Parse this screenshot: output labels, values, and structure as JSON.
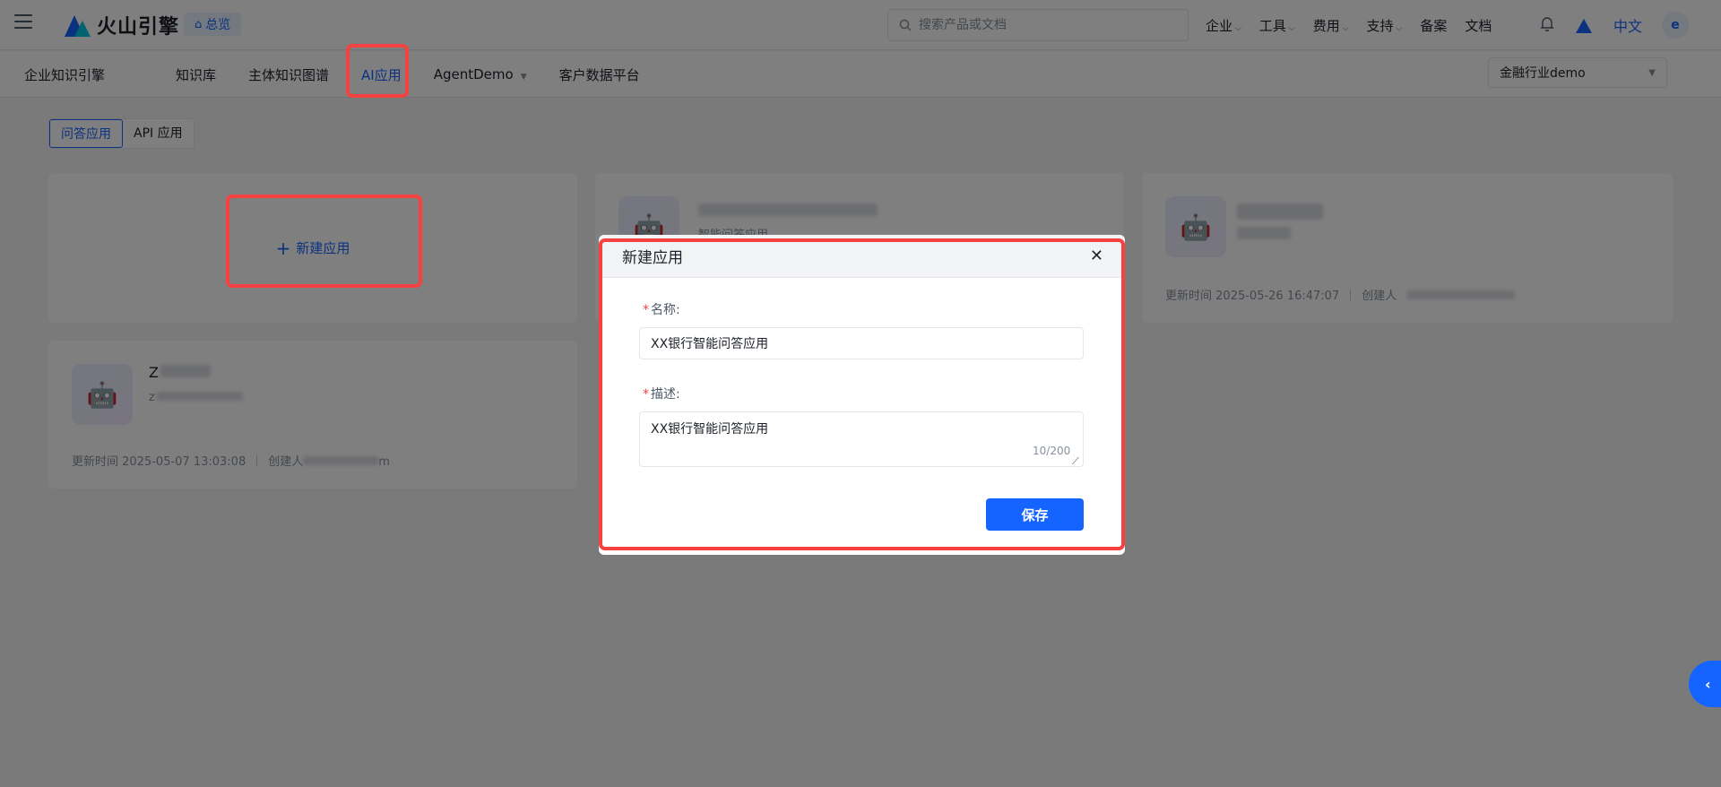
{
  "topbar": {
    "logo_text": "火山引擎",
    "home_label": "总览",
    "search_placeholder": "搜索产品或文档",
    "nav": [
      {
        "label": "企业",
        "has_caret": true
      },
      {
        "label": "工具",
        "has_caret": true
      },
      {
        "label": "费用",
        "has_caret": true
      },
      {
        "label": "支持",
        "has_caret": true
      },
      {
        "label": "备案",
        "has_caret": false
      },
      {
        "label": "文档",
        "has_caret": false
      }
    ],
    "language": "中文",
    "avatar_letter": "e"
  },
  "subnav": {
    "brand": "企业知识引擎",
    "tabs": [
      {
        "label": "知识库"
      },
      {
        "label": "主体知识图谱"
      },
      {
        "label": "AI应用",
        "active": true
      },
      {
        "label": "AgentDemo"
      },
      {
        "label": "客户数据平台"
      }
    ],
    "workspace_select": "金融行业demo"
  },
  "segment": {
    "items": [
      "问答应用",
      "API 应用"
    ],
    "active_index": 0
  },
  "new_app_card": {
    "label": "新建应用"
  },
  "app_cards": [
    {
      "title": "Z",
      "sub": "z",
      "updated_label": "更新时间",
      "updated_at": "2025-05-07 13:03:08",
      "creator_label": "创建人",
      "creator_suffix": "m"
    },
    {
      "sub": "智能问答应用"
    },
    {
      "updated_label": "更新时间",
      "updated_at": "2025-05-26 16:47:07",
      "creator_label": "创建人"
    }
  ],
  "modal": {
    "title": "新建应用",
    "name_label": "名称:",
    "name_value": "XX银行智能问答应用",
    "desc_label": "描述:",
    "desc_value": "XX银行智能问答应用",
    "desc_counter": "10/200",
    "save_label": "保存",
    "required_mark": "*"
  },
  "colors": {
    "accent": "#1664ff",
    "highlight": "#f5413f",
    "required": "#f53f3f"
  },
  "icons": {
    "menu": "hamburger-icon",
    "home": "home-icon",
    "search": "search-icon",
    "bell": "bell-icon",
    "close": "close-icon",
    "robot": "robot-icon",
    "collapse": "chevron-left-icon"
  }
}
